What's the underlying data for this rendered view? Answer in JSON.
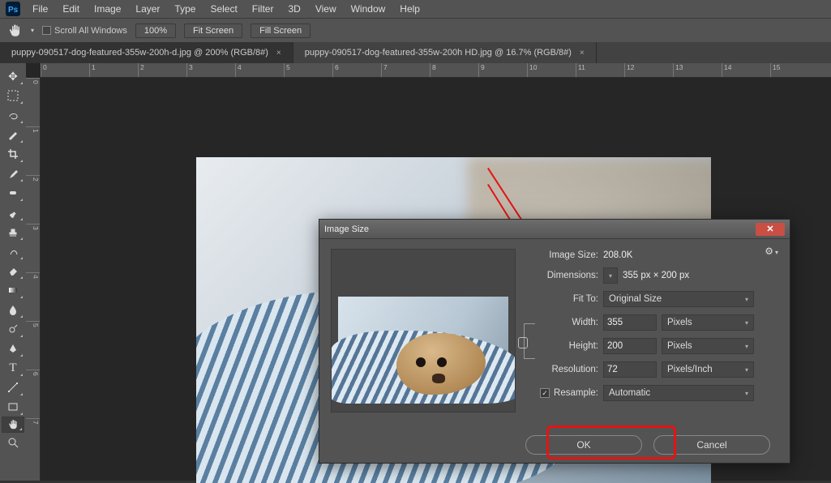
{
  "menubar": {
    "items": [
      "File",
      "Edit",
      "Image",
      "Layer",
      "Type",
      "Select",
      "Filter",
      "3D",
      "View",
      "Window",
      "Help"
    ]
  },
  "optionsbar": {
    "scroll_all": "Scroll All Windows",
    "zoom": "100%",
    "fit": "Fit Screen",
    "fill": "Fill Screen"
  },
  "tabs": [
    {
      "label": "puppy-090517-dog-featured-355w-200h-d.jpg @ 200% (RGB/8#)",
      "active": true
    },
    {
      "label": "puppy-090517-dog-featured-355w-200h HD.jpg @ 16.7% (RGB/8#)",
      "active": false
    }
  ],
  "ruler_h": [
    "0",
    "1",
    "2",
    "3",
    "4",
    "5",
    "6",
    "7",
    "8",
    "9",
    "10",
    "11",
    "12",
    "13",
    "14",
    "15"
  ],
  "ruler_v": [
    "0",
    "1",
    "2",
    "3",
    "4",
    "5",
    "6",
    "7"
  ],
  "dialog": {
    "title": "Image Size",
    "image_size_label": "Image Size:",
    "image_size_value": "208.0K",
    "dimensions_label": "Dimensions:",
    "dimensions_value": "355 px  ×  200 px",
    "fit_to_label": "Fit To:",
    "fit_to_value": "Original Size",
    "width_label": "Width:",
    "width_value": "355",
    "width_unit": "Pixels",
    "height_label": "Height:",
    "height_value": "200",
    "height_unit": "Pixels",
    "resolution_label": "Resolution:",
    "resolution_value": "72",
    "resolution_unit": "Pixels/Inch",
    "resample_label": "Resample:",
    "resample_value": "Automatic",
    "ok": "OK",
    "cancel": "Cancel"
  },
  "tools": [
    "move",
    "marquee",
    "lasso",
    "wand",
    "crop",
    "eyedrop",
    "heal",
    "brush",
    "stamp",
    "history",
    "eraser",
    "gradient",
    "blur",
    "dodge",
    "pen",
    "type",
    "path",
    "shape",
    "hand",
    "zoom"
  ]
}
